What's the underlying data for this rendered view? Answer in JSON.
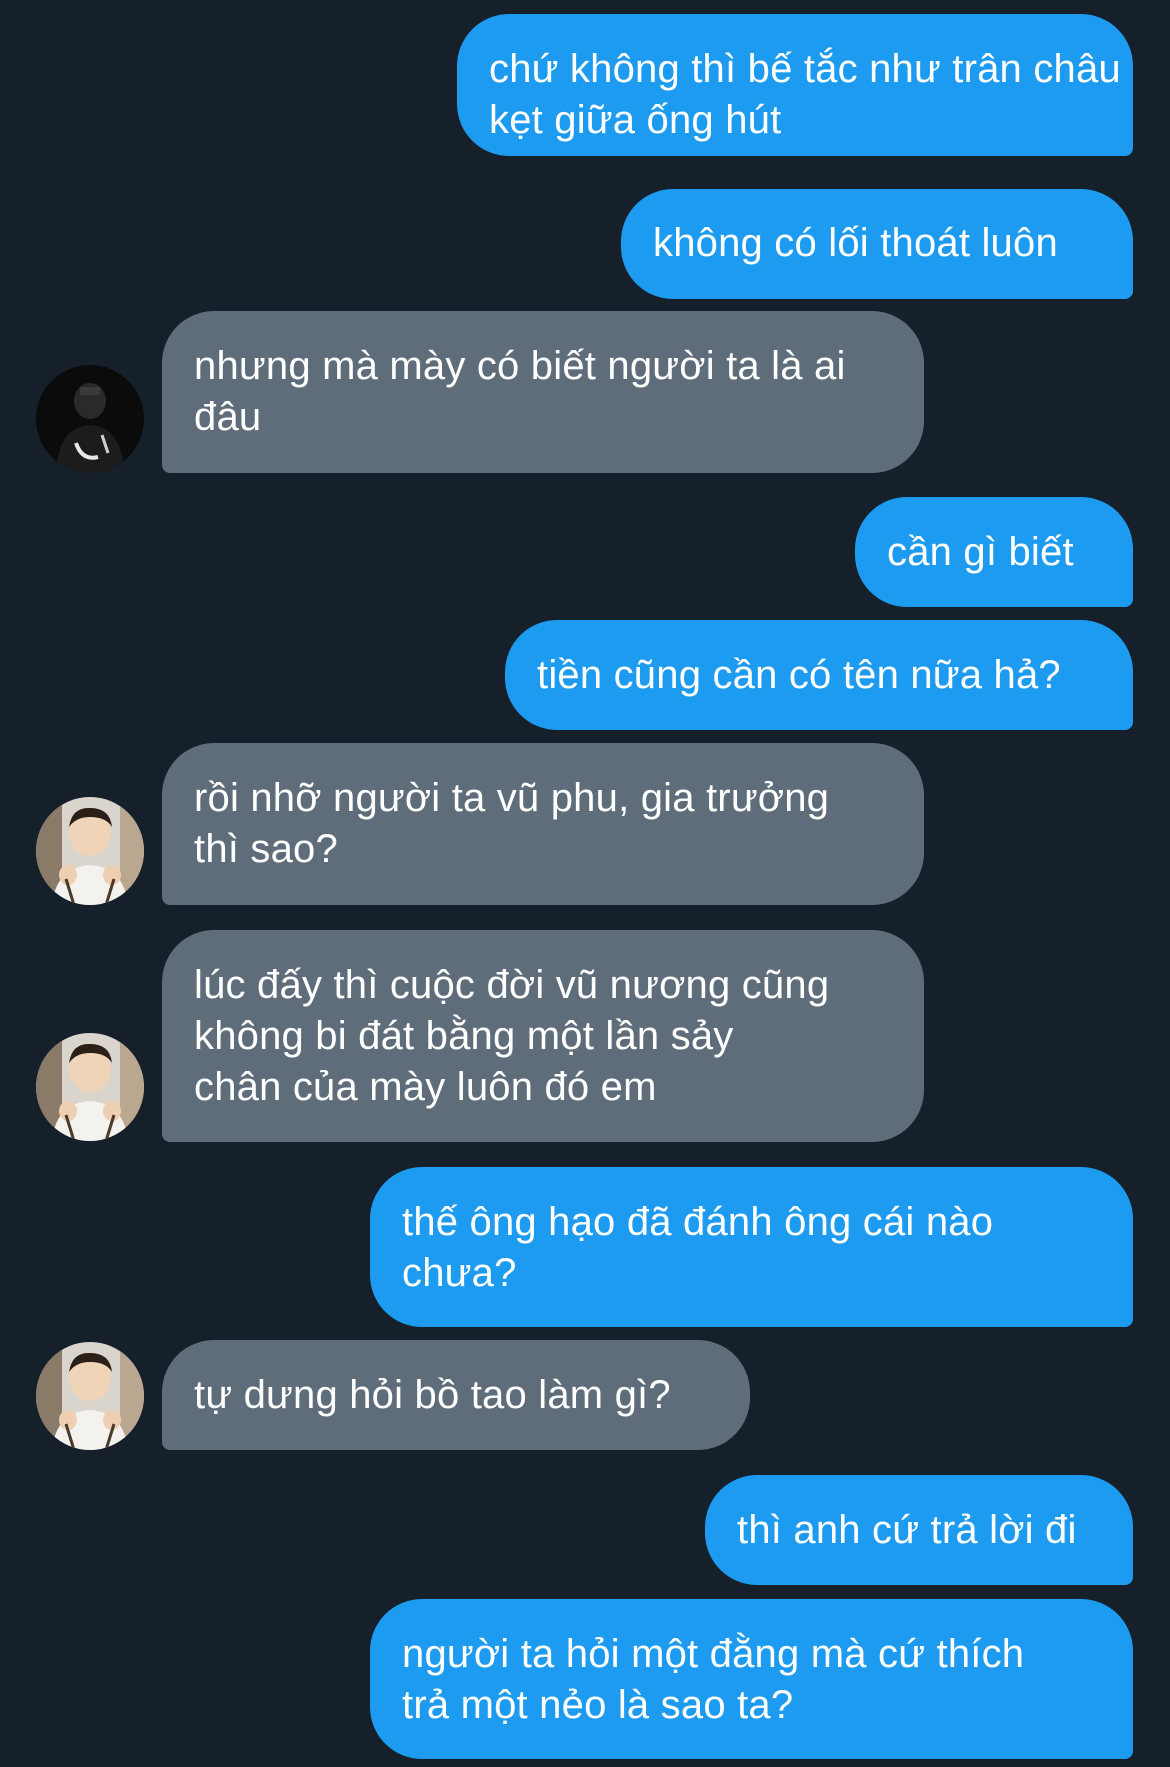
{
  "messages": [
    {
      "id": 1,
      "side": "sent",
      "lines": [
        "chứ không thì bế tắc như trân châu",
        "kẹt giữa ống hút"
      ]
    },
    {
      "id": 2,
      "side": "sent",
      "lines": [
        "không có lối thoát luôn"
      ]
    },
    {
      "id": 3,
      "side": "received",
      "avatar": "dark-avatar",
      "lines": [
        "nhưng mà mày có biết người ta là ai",
        "đâu"
      ]
    },
    {
      "id": 4,
      "side": "sent",
      "lines": [
        "cần gì biết"
      ]
    },
    {
      "id": 5,
      "side": "sent",
      "lines": [
        "tiền cũng cần có tên nữa hả?"
      ]
    },
    {
      "id": 6,
      "side": "received",
      "avatar": "smiling-person-avatar",
      "lines": [
        "rồi nhỡ người ta vũ phu, gia trưởng",
        "thì sao?"
      ]
    },
    {
      "id": 7,
      "side": "received",
      "avatar": "smiling-person-avatar",
      "lines": [
        "lúc đấy thì cuộc đời vũ nương cũng",
        "không bi đát bằng một lần sảy",
        "chân của mày luôn đó em"
      ]
    },
    {
      "id": 8,
      "side": "sent",
      "lines": [
        "thế ông hạo đã đánh ông cái nào",
        "chưa?"
      ]
    },
    {
      "id": 9,
      "side": "received",
      "avatar": "smiling-person-avatar",
      "lines": [
        "tự dưng hỏi bồ tao làm gì?"
      ]
    },
    {
      "id": 10,
      "side": "sent",
      "lines": [
        "thì anh cứ trả lời đi"
      ]
    },
    {
      "id": 11,
      "side": "sent",
      "lines": [
        "người ta hỏi một đằng mà cứ thích",
        "trả một nẻo là sao ta?"
      ]
    }
  ],
  "colors": {
    "background": "#15202b",
    "sent_bubble": "#1d9bf0",
    "received_bubble": "#5f6d7b",
    "text": "#ffffff"
  }
}
